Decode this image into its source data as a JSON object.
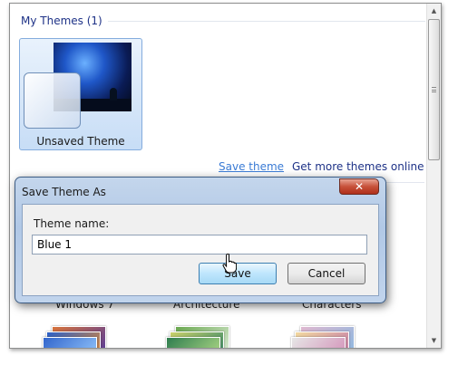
{
  "panel": {
    "group_title": "My Themes (1)",
    "theme": {
      "name": "Unsaved Theme"
    },
    "save_theme_link": "Save theme",
    "get_more_link": "Get more themes online"
  },
  "background_themes": [
    {
      "label": "Windows 7"
    },
    {
      "label": "Architecture"
    },
    {
      "label": "Characters"
    }
  ],
  "dialog": {
    "title": "Save Theme As",
    "close_symbol": "✕",
    "field_label": "Theme name:",
    "field_value": "Blue 1",
    "save_button": "Save",
    "cancel_button": "Cancel"
  },
  "colors": {
    "accent_link": "#3a7bd5",
    "header_text": "#1e3287",
    "close_button": "#c7513a",
    "dialog_frame": "#b1c8e6"
  },
  "icons": {
    "close": "close-icon",
    "scroll_up": "scroll-up-arrow-icon",
    "scroll_down": "scroll-down-arrow-icon",
    "cursor": "hand-pointer-icon"
  }
}
